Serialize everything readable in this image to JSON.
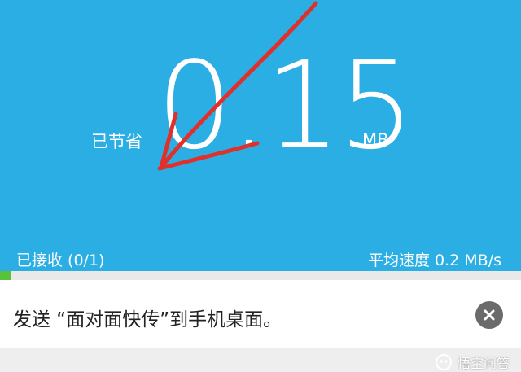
{
  "saved": {
    "label": "已节省",
    "value": "0.15",
    "unit": "MB"
  },
  "transfer": {
    "received": "已接收 (0/1)",
    "speed": "平均速度 0.2 MB/s",
    "progress_fraction": 0.02
  },
  "tip": {
    "text": "发送 “面对面快传”到手机桌面。"
  },
  "watermark": {
    "text": "悟空问答"
  },
  "icons": {
    "close": "close-icon",
    "annotation": "red-arrow-annotation",
    "logo": "wukong-logo-icon"
  },
  "colors": {
    "hero_bg": "#2aaee4",
    "progress_fill": "#58c23a",
    "annotation": "#e0302c"
  }
}
